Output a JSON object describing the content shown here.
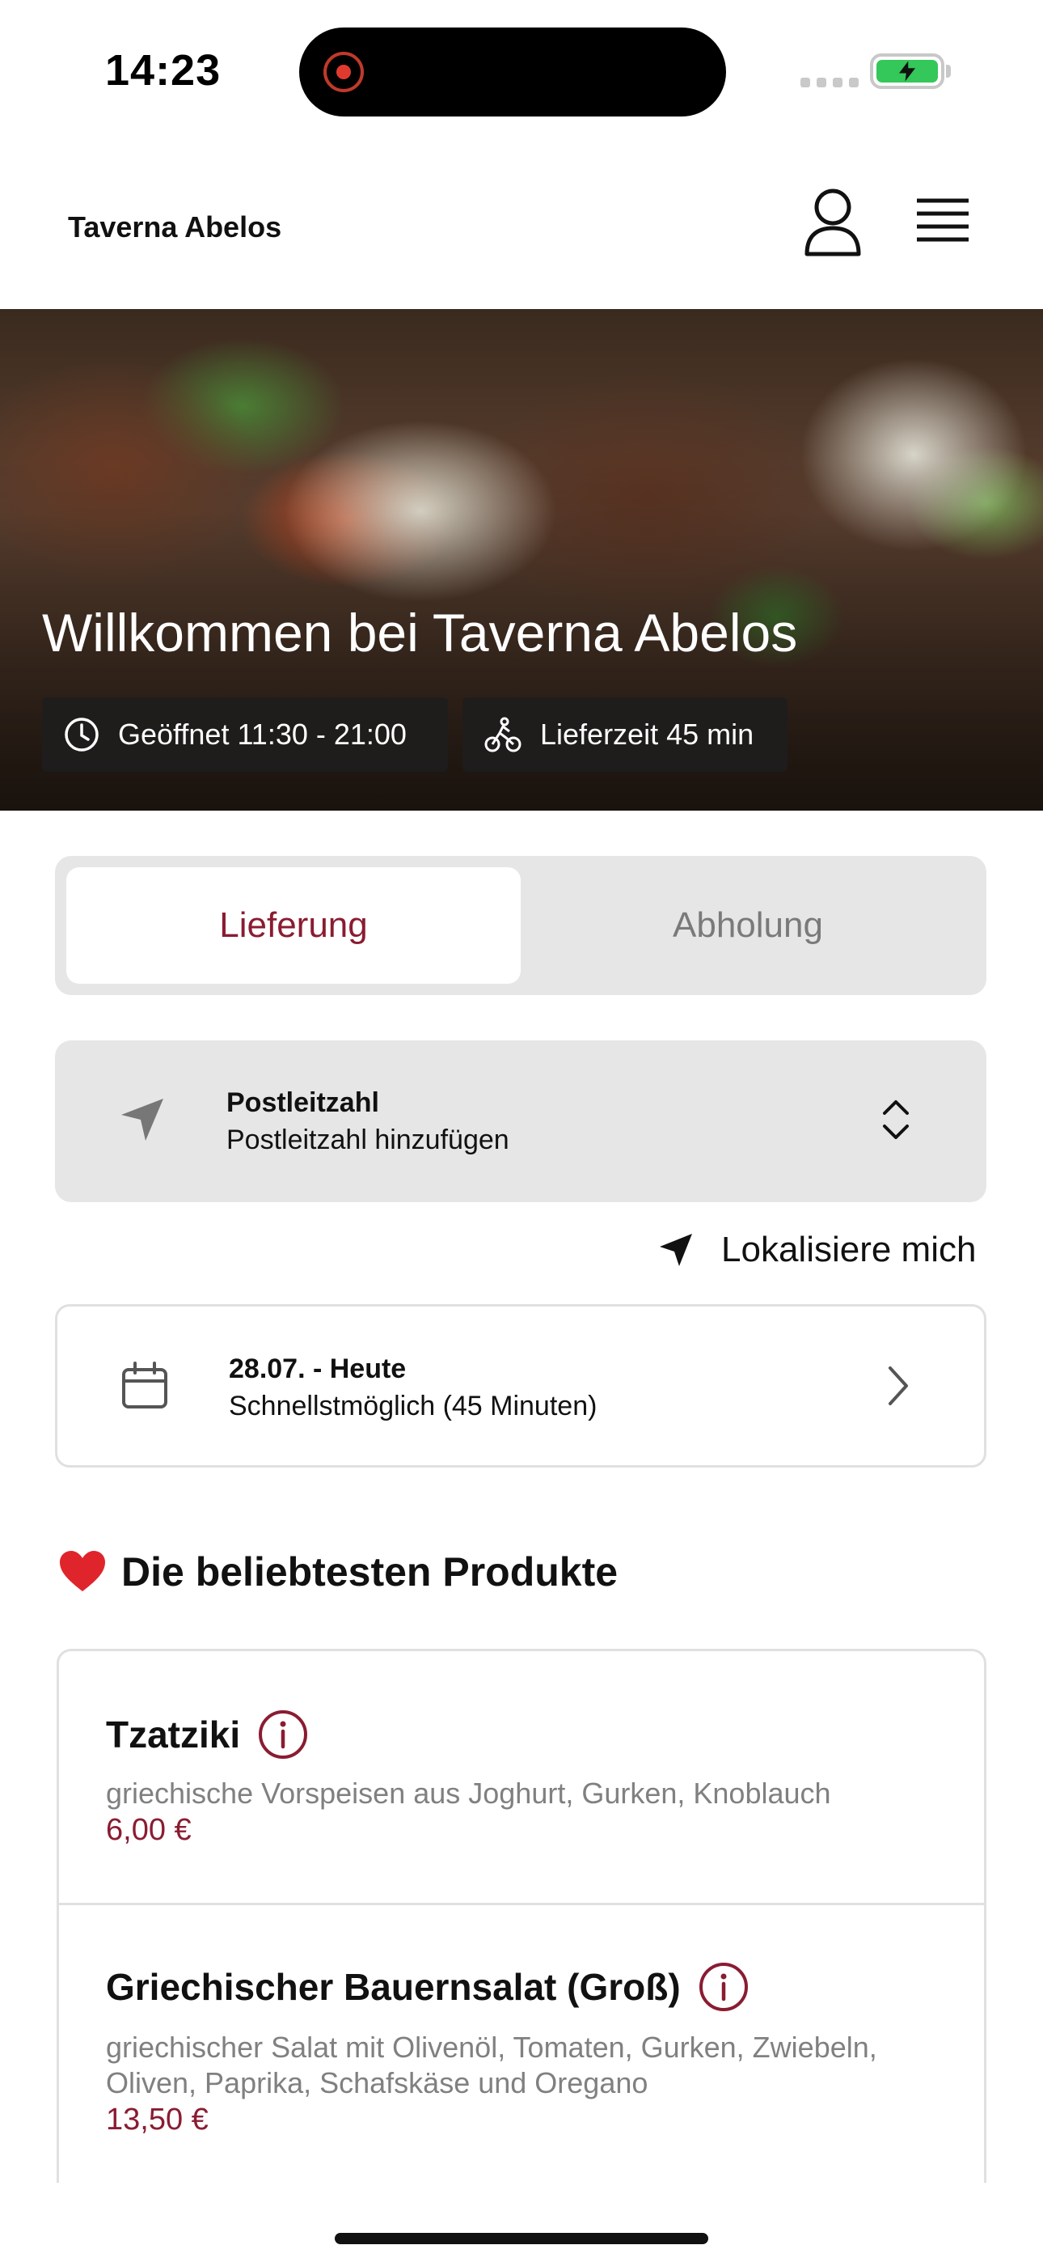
{
  "status_bar": {
    "time": "14:23"
  },
  "header": {
    "brand": "Taverna Abelos",
    "icons": {
      "user": "user-icon",
      "menu": "hamburger-menu-icon"
    }
  },
  "hero": {
    "title": "Willkommen bei Taverna Abelos",
    "opening_hours": "Geöffnet 11:30 - 21:00",
    "delivery_time": "Lieferzeit 45 min"
  },
  "order_mode": {
    "tabs": [
      {
        "label": "Lieferung",
        "selected": true
      },
      {
        "label": "Abholung",
        "selected": false
      }
    ]
  },
  "postcode": {
    "label": "Postleitzahl",
    "value": "Postleitzahl hinzufügen"
  },
  "locate": {
    "label": "Lokalisiere mich"
  },
  "delivery_date": {
    "label": "28.07. - Heute",
    "value": "Schnellstmöglich (45 Minuten)"
  },
  "popular": {
    "emoji": "❤️",
    "title": "Die beliebtesten Produkte",
    "products": [
      {
        "name": "Tzatziki",
        "description": "griechische Vorspeisen aus Joghurt, Gurken, Knoblauch",
        "price": "6,00 €"
      },
      {
        "name": "Griechischer Bauernsalat (Groß)",
        "description": "griechischer Salat mit Olivenöl, Tomaten, Gurken, Zwiebeln, Oliven, Paprika, Schafskäse und Oregano",
        "price": "13,50 €"
      }
    ]
  },
  "colors": {
    "accent": "#8a1c31",
    "battery": "#34c759",
    "panel": "#e6e6e6"
  }
}
